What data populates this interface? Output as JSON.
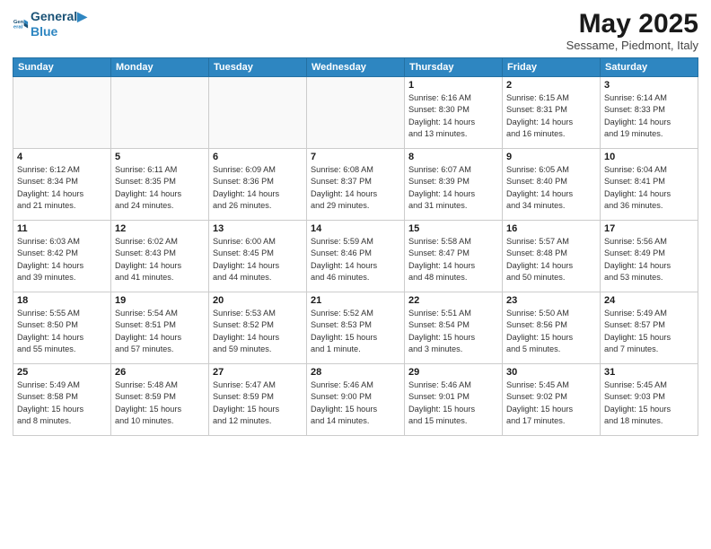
{
  "logo": {
    "line1": "General",
    "line2": "Blue"
  },
  "title": "May 2025",
  "subtitle": "Sessame, Piedmont, Italy",
  "headers": [
    "Sunday",
    "Monday",
    "Tuesday",
    "Wednesday",
    "Thursday",
    "Friday",
    "Saturday"
  ],
  "weeks": [
    [
      {
        "day": "",
        "content": ""
      },
      {
        "day": "",
        "content": ""
      },
      {
        "day": "",
        "content": ""
      },
      {
        "day": "",
        "content": ""
      },
      {
        "day": "1",
        "content": "Sunrise: 6:16 AM\nSunset: 8:30 PM\nDaylight: 14 hours\nand 13 minutes."
      },
      {
        "day": "2",
        "content": "Sunrise: 6:15 AM\nSunset: 8:31 PM\nDaylight: 14 hours\nand 16 minutes."
      },
      {
        "day": "3",
        "content": "Sunrise: 6:14 AM\nSunset: 8:33 PM\nDaylight: 14 hours\nand 19 minutes."
      }
    ],
    [
      {
        "day": "4",
        "content": "Sunrise: 6:12 AM\nSunset: 8:34 PM\nDaylight: 14 hours\nand 21 minutes."
      },
      {
        "day": "5",
        "content": "Sunrise: 6:11 AM\nSunset: 8:35 PM\nDaylight: 14 hours\nand 24 minutes."
      },
      {
        "day": "6",
        "content": "Sunrise: 6:09 AM\nSunset: 8:36 PM\nDaylight: 14 hours\nand 26 minutes."
      },
      {
        "day": "7",
        "content": "Sunrise: 6:08 AM\nSunset: 8:37 PM\nDaylight: 14 hours\nand 29 minutes."
      },
      {
        "day": "8",
        "content": "Sunrise: 6:07 AM\nSunset: 8:39 PM\nDaylight: 14 hours\nand 31 minutes."
      },
      {
        "day": "9",
        "content": "Sunrise: 6:05 AM\nSunset: 8:40 PM\nDaylight: 14 hours\nand 34 minutes."
      },
      {
        "day": "10",
        "content": "Sunrise: 6:04 AM\nSunset: 8:41 PM\nDaylight: 14 hours\nand 36 minutes."
      }
    ],
    [
      {
        "day": "11",
        "content": "Sunrise: 6:03 AM\nSunset: 8:42 PM\nDaylight: 14 hours\nand 39 minutes."
      },
      {
        "day": "12",
        "content": "Sunrise: 6:02 AM\nSunset: 8:43 PM\nDaylight: 14 hours\nand 41 minutes."
      },
      {
        "day": "13",
        "content": "Sunrise: 6:00 AM\nSunset: 8:45 PM\nDaylight: 14 hours\nand 44 minutes."
      },
      {
        "day": "14",
        "content": "Sunrise: 5:59 AM\nSunset: 8:46 PM\nDaylight: 14 hours\nand 46 minutes."
      },
      {
        "day": "15",
        "content": "Sunrise: 5:58 AM\nSunset: 8:47 PM\nDaylight: 14 hours\nand 48 minutes."
      },
      {
        "day": "16",
        "content": "Sunrise: 5:57 AM\nSunset: 8:48 PM\nDaylight: 14 hours\nand 50 minutes."
      },
      {
        "day": "17",
        "content": "Sunrise: 5:56 AM\nSunset: 8:49 PM\nDaylight: 14 hours\nand 53 minutes."
      }
    ],
    [
      {
        "day": "18",
        "content": "Sunrise: 5:55 AM\nSunset: 8:50 PM\nDaylight: 14 hours\nand 55 minutes."
      },
      {
        "day": "19",
        "content": "Sunrise: 5:54 AM\nSunset: 8:51 PM\nDaylight: 14 hours\nand 57 minutes."
      },
      {
        "day": "20",
        "content": "Sunrise: 5:53 AM\nSunset: 8:52 PM\nDaylight: 14 hours\nand 59 minutes."
      },
      {
        "day": "21",
        "content": "Sunrise: 5:52 AM\nSunset: 8:53 PM\nDaylight: 15 hours\nand 1 minute."
      },
      {
        "day": "22",
        "content": "Sunrise: 5:51 AM\nSunset: 8:54 PM\nDaylight: 15 hours\nand 3 minutes."
      },
      {
        "day": "23",
        "content": "Sunrise: 5:50 AM\nSunset: 8:56 PM\nDaylight: 15 hours\nand 5 minutes."
      },
      {
        "day": "24",
        "content": "Sunrise: 5:49 AM\nSunset: 8:57 PM\nDaylight: 15 hours\nand 7 minutes."
      }
    ],
    [
      {
        "day": "25",
        "content": "Sunrise: 5:49 AM\nSunset: 8:58 PM\nDaylight: 15 hours\nand 8 minutes."
      },
      {
        "day": "26",
        "content": "Sunrise: 5:48 AM\nSunset: 8:59 PM\nDaylight: 15 hours\nand 10 minutes."
      },
      {
        "day": "27",
        "content": "Sunrise: 5:47 AM\nSunset: 8:59 PM\nDaylight: 15 hours\nand 12 minutes."
      },
      {
        "day": "28",
        "content": "Sunrise: 5:46 AM\nSunset: 9:00 PM\nDaylight: 15 hours\nand 14 minutes."
      },
      {
        "day": "29",
        "content": "Sunrise: 5:46 AM\nSunset: 9:01 PM\nDaylight: 15 hours\nand 15 minutes."
      },
      {
        "day": "30",
        "content": "Sunrise: 5:45 AM\nSunset: 9:02 PM\nDaylight: 15 hours\nand 17 minutes."
      },
      {
        "day": "31",
        "content": "Sunrise: 5:45 AM\nSunset: 9:03 PM\nDaylight: 15 hours\nand 18 minutes."
      }
    ]
  ]
}
